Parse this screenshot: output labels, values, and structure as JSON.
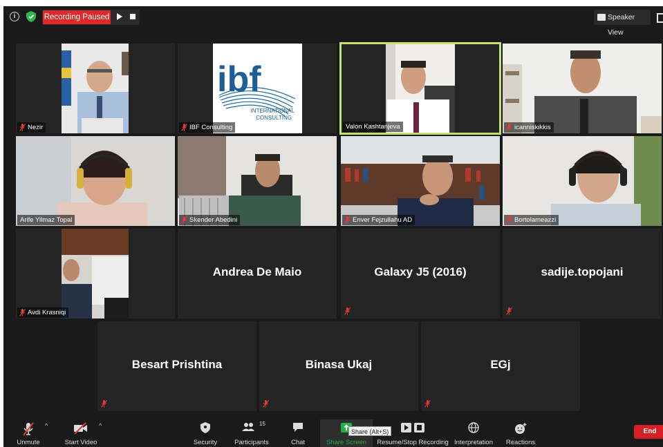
{
  "topbar": {
    "recording_label": "Recording Paused",
    "speaker_view_label": "Speaker View"
  },
  "tiles": [
    {
      "name": "Nezir",
      "muted": true,
      "big": false
    },
    {
      "name": "IBF Consulting",
      "muted": true,
      "big": false
    },
    {
      "name": "Valon Kashtanjeva",
      "muted": false,
      "big": false,
      "active": true
    },
    {
      "name": "icanniskikkis",
      "muted": true,
      "big": false
    },
    {
      "name": "Arife Yilmaz Topal",
      "muted": false,
      "big": false
    },
    {
      "name": "Skender Abedini",
      "muted": true,
      "big": false
    },
    {
      "name": "Enver Fejzullahu AD",
      "muted": true,
      "big": false
    },
    {
      "name": "Bortolameazzi",
      "muted": true,
      "big": false
    },
    {
      "name": "Avdi Krasniqi",
      "muted": true,
      "big": false
    },
    {
      "name": "Andrea De Maio",
      "muted": false,
      "big": true
    },
    {
      "name": "Galaxy J5 (2016)",
      "muted": true,
      "big": true
    },
    {
      "name": "sadije.topojani",
      "muted": true,
      "big": true
    },
    {
      "name": "Besart Prishtina",
      "muted": true,
      "big": true
    },
    {
      "name": "Binasa Ukaj",
      "muted": true,
      "big": true
    },
    {
      "name": "EGj",
      "muted": true,
      "big": true
    }
  ],
  "ibf_logo": {
    "text": "ibf",
    "subtitle_line1": "INTERNATIONAL",
    "subtitle_line2": "CONSULTING"
  },
  "toolbar": {
    "unmute": "Unmute",
    "start_video": "Start Video",
    "security": "Security",
    "participants": "Participants",
    "participants_count": "15",
    "chat": "Chat",
    "share_screen": "Share Screen",
    "recording": "Resume/Stop Recording",
    "interpretation": "Interpretation",
    "reactions": "Reactions",
    "end": "End",
    "share_tooltip": "Share (Alt+S)"
  },
  "colors": {
    "active_speaker_border": "#c6e36e",
    "recording_red": "#e0272b",
    "share_green": "#22b04b",
    "end_red": "#d81f26",
    "muted_icon": "#e33b3b"
  }
}
